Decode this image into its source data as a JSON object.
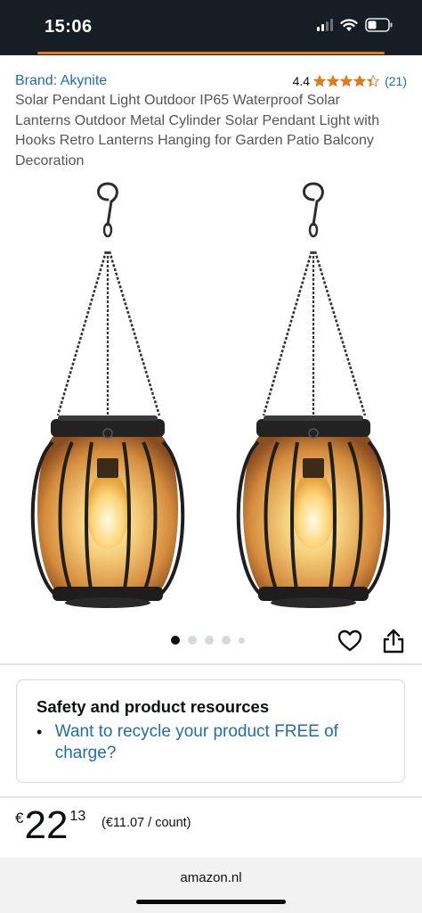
{
  "status_bar": {
    "time": "15:06",
    "icons": [
      "cellular-signal-icon",
      "wifi-icon",
      "battery-icon"
    ]
  },
  "colors": {
    "status_bg": "#161d24",
    "accent_orange": "#e47911",
    "link_blue": "#1f6ea8",
    "star_orange": "#e47911"
  },
  "product": {
    "brand": "Brand: Akynite",
    "rating_value": "4.4",
    "rating_stars": 4.4,
    "rating_count": "(21)",
    "title": "Solar Pendant Light Outdoor IP65 Waterproof Solar Lanterns Outdoor Metal Cylinder Solar Pendant Light with Hooks Retro Lanterns Hanging for Garden Patio Balcony Decoration"
  },
  "carousel": {
    "total_dots": 5,
    "active_index": 0
  },
  "actions": {
    "icons": [
      "heart-icon",
      "share-icon"
    ]
  },
  "safety": {
    "heading": "Safety and product resources",
    "link": "Want to recycle your product FREE of charge?"
  },
  "price": {
    "currency": "€",
    "whole": "22",
    "fraction": "13",
    "unit_price": "(€11.07 / count)"
  },
  "browser": {
    "url": "amazon.nl"
  }
}
